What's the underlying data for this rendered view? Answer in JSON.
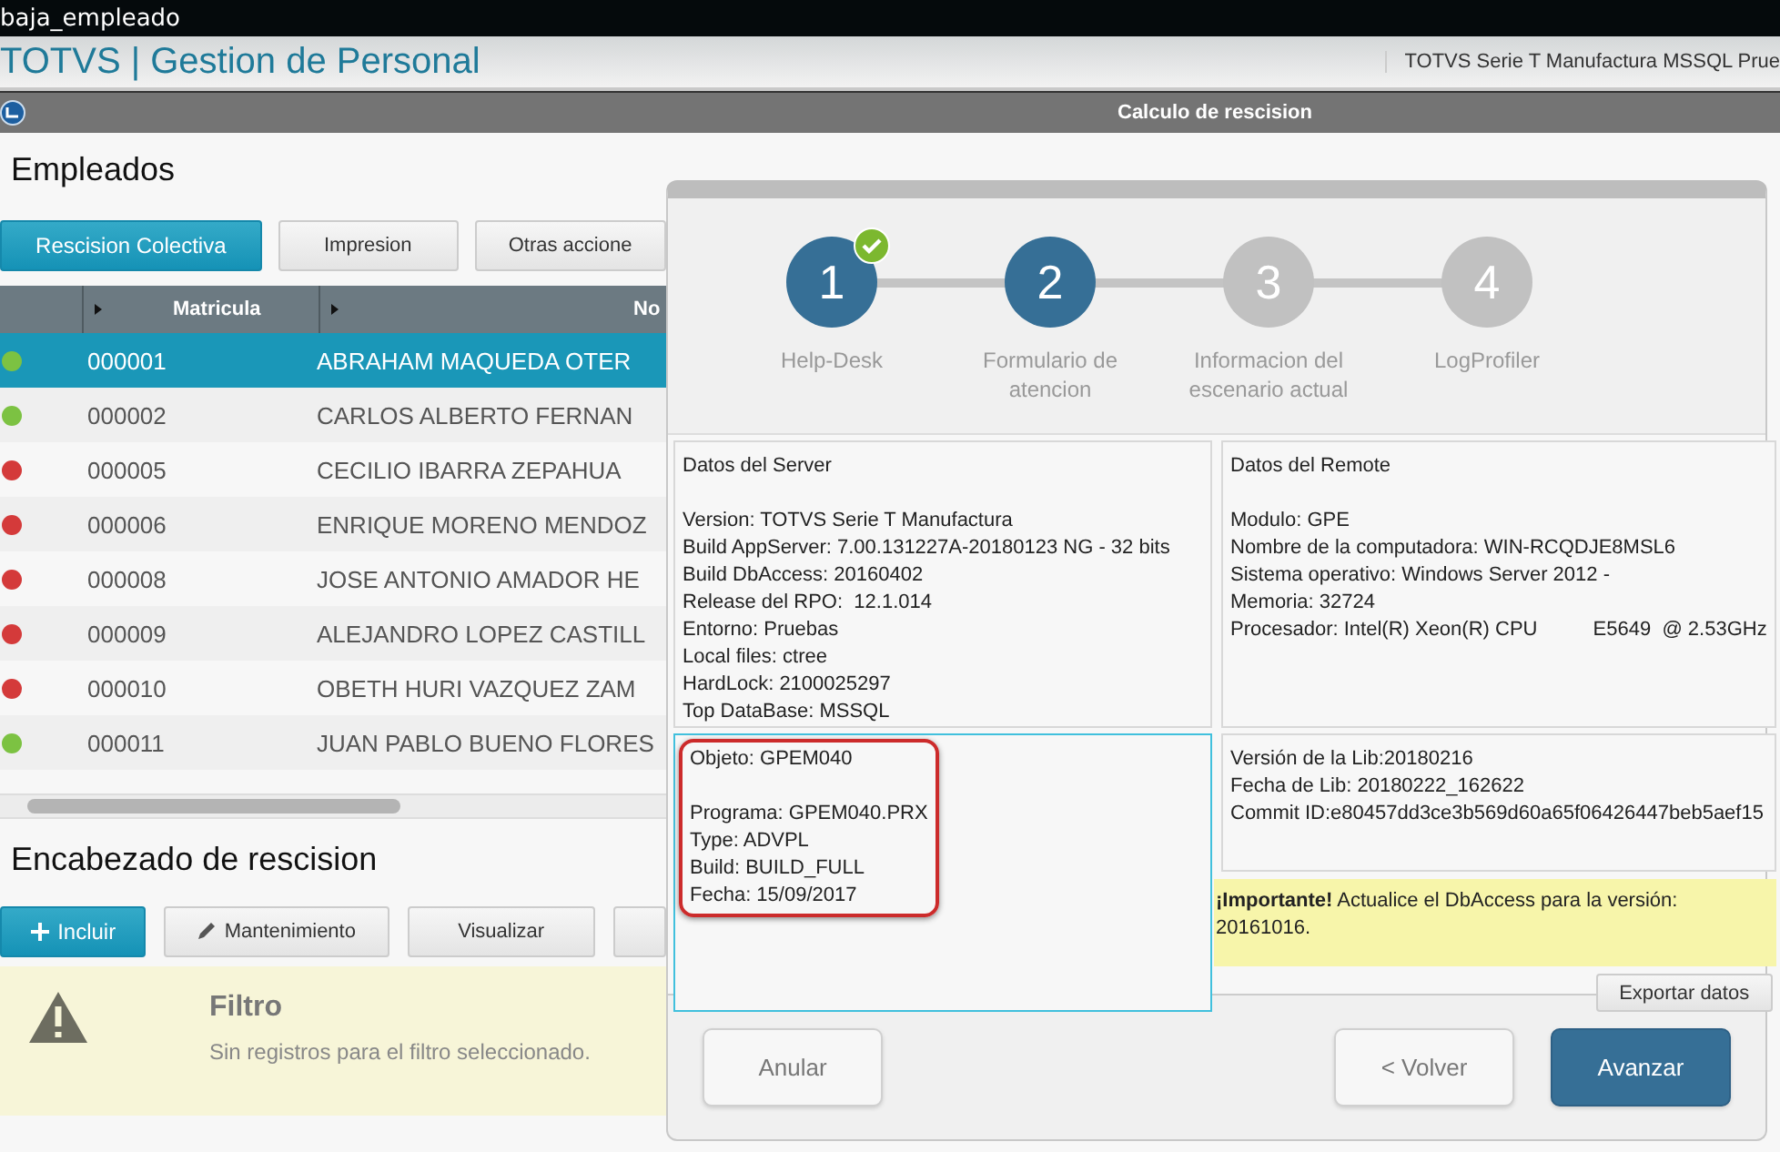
{
  "tab": {
    "label": "baja_empleado"
  },
  "header": {
    "title": "TOTVS | Gestion de Personal",
    "environment": "TOTVS Serie T Manufactura MSSQL Prue"
  },
  "window": {
    "title": "Calculo de rescision"
  },
  "employees": {
    "title": "Empleados",
    "actions": [
      {
        "label": "Rescision Colectiva",
        "kind": "primary"
      },
      {
        "label": "Impresion",
        "kind": "plain"
      },
      {
        "label": "Otras accione",
        "kind": "plain"
      }
    ],
    "columns": [
      "Matricula",
      "No"
    ],
    "rows": [
      {
        "color": "#7cc242",
        "id": "000001",
        "name": "ABRAHAM MAQUEDA OTER",
        "selected": true
      },
      {
        "color": "#7cc242",
        "id": "000002",
        "name": "CARLOS ALBERTO FERNAN",
        "selected": false
      },
      {
        "color": "#d43a3a",
        "id": "000005",
        "name": "CECILIO IBARRA ZEPAHUA",
        "selected": false
      },
      {
        "color": "#d43a3a",
        "id": "000006",
        "name": "ENRIQUE MORENO MENDOZ",
        "selected": false
      },
      {
        "color": "#d43a3a",
        "id": "000008",
        "name": "JOSE ANTONIO AMADOR HE",
        "selected": false
      },
      {
        "color": "#d43a3a",
        "id": "000009",
        "name": "ALEJANDRO LOPEZ CASTILL",
        "selected": false
      },
      {
        "color": "#d43a3a",
        "id": "000010",
        "name": "OBETH HURI VAZQUEZ ZAM",
        "selected": false
      },
      {
        "color": "#7cc242",
        "id": "000011",
        "name": "JUAN PABLO BUENO FLORES",
        "selected": false
      }
    ]
  },
  "rescision": {
    "title": "Encabezado de rescision",
    "actions": [
      {
        "label": "Incluir",
        "kind": "add"
      },
      {
        "label": "Mantenimiento",
        "kind": "edit"
      },
      {
        "label": "Visualizar",
        "kind": "plain"
      },
      {
        "kind": "stub"
      }
    ],
    "notice": {
      "title": "Filtro",
      "text": "Sin registros para el filtro seleccionado."
    }
  },
  "dialog": {
    "steps": [
      {
        "number": "1",
        "label": "Help-Desk",
        "reached": true,
        "completed": true
      },
      {
        "number": "2",
        "label": "Formulario de atencion",
        "reached": true,
        "completed": false
      },
      {
        "number": "3",
        "label": "Informacion del escenario actual",
        "reached": false,
        "completed": false
      },
      {
        "number": "4",
        "label": "LogProfiler",
        "reached": false,
        "completed": false
      }
    ],
    "panels": [
      {
        "title": "Datos del Server",
        "lines": [
          "Version: TOTVS Serie T Manufactura",
          "Build AppServer: 7.00.131227A-20180123 NG - 32 bits",
          "Build DbAccess: 20160402",
          "Release del RPO:  12.1.014",
          "Entorno: Pruebas",
          "Local files: ctree",
          "HardLock: 2100025297",
          "Top DataBase: MSSQL"
        ],
        "focused": false,
        "highlighted": false
      },
      {
        "title": "Datos del Remote",
        "lines": [
          "Modulo: GPE",
          "Nombre de la computadora: WIN-RCQDJE8MSL6",
          "Sistema operativo: Windows Server 2012 -",
          "Memoria: 32724",
          "Procesador: Intel(R) Xeon(R) CPU          E5649  @ 2.53GHz"
        ],
        "focused": false,
        "highlighted": false
      },
      {
        "title": "Objeto: GPEM040",
        "lines": [
          "Programa: GPEM040.PRX",
          "Type: ADVPL",
          "Build: BUILD_FULL",
          "Fecha: 15/09/2017"
        ],
        "focused": true,
        "highlighted": true
      },
      {
        "lines": [
          "Versión de la Lib:20180216",
          "Fecha de Lib: 20180222_162622",
          "Commit ID:e80457dd3ce3b569d60a65f06426447beb5aef15"
        ],
        "focused": false,
        "highlighted": false
      }
    ],
    "note": "**¡Importante!** Actualice el DbAccess para la versión: 20161016.",
    "export_button": "Exportar datos",
    "buttons": [
      {
        "label": "Anular",
        "kind": "secondary"
      },
      {
        "label": "< Volver",
        "kind": "secondary"
      },
      {
        "label": "Avanzar",
        "kind": "primary"
      }
    ]
  }
}
